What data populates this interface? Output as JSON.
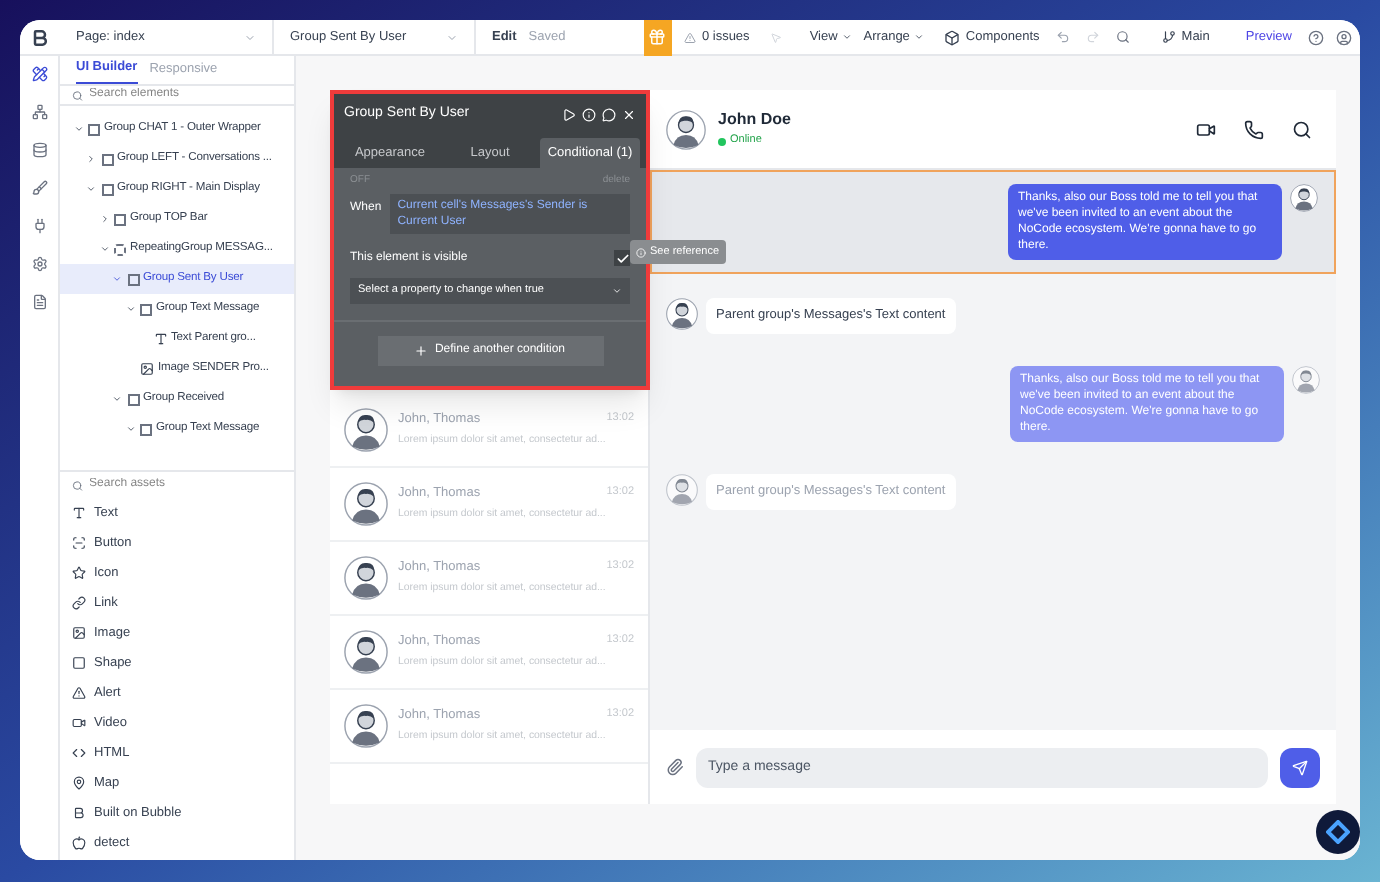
{
  "topbar": {
    "page": "Page: index",
    "element": "Group Sent By User",
    "edit": "Edit",
    "saved": "Saved",
    "issues": "0 issues",
    "view": "View",
    "arrange": "Arrange",
    "components": "Components",
    "branch": "Main",
    "preview": "Preview"
  },
  "left_panel": {
    "tabs": [
      {
        "label": "UI Builder",
        "selected": true
      },
      {
        "label": "Responsive",
        "selected": false
      }
    ],
    "search": {
      "placeholder": "Search elements"
    },
    "layers": [
      {
        "kind": "group",
        "label": "Group CHAT 1 - Outer Wrapper",
        "expanded": true,
        "selected": false,
        "children": [
          {
            "kind": "group",
            "label": "Group LEFT - Conversations ...",
            "expanded": false,
            "selected": false
          },
          {
            "kind": "group",
            "label": "Group RIGHT - Main Display",
            "expanded": true,
            "selected": false,
            "children": [
              {
                "kind": "group",
                "label": "Group TOP Bar",
                "expanded": false,
                "selected": false
              },
              {
                "kind": "repeating",
                "label": "RepeatingGroup MESSAG...",
                "expanded": true,
                "selected": false,
                "children": [
                  {
                    "kind": "group",
                    "label": "Group Sent By User",
                    "expanded": true,
                    "selected": true,
                    "children": [
                      {
                        "kind": "group",
                        "label": "Group Text Message",
                        "expanded": true,
                        "selected": false,
                        "children": [
                          {
                            "kind": "text",
                            "label": "Text Parent gro...",
                            "selected": false
                          }
                        ]
                      },
                      {
                        "kind": "image",
                        "label": "Image SENDER Pro...",
                        "selected": false
                      }
                    ]
                  },
                  {
                    "kind": "group",
                    "label": "Group Received",
                    "expanded": true,
                    "selected": false,
                    "children": [
                      {
                        "kind": "group",
                        "label": "Group Text Message",
                        "expanded": true,
                        "selected": false
                      }
                    ]
                  }
                ]
              }
            ]
          }
        ]
      }
    ],
    "assets_search": {
      "placeholder": "Search assets"
    },
    "assets": [
      {
        "label": "Text"
      },
      {
        "label": "Button"
      },
      {
        "label": "Icon"
      },
      {
        "label": "Link"
      },
      {
        "label": "Image"
      },
      {
        "label": "Shape"
      },
      {
        "label": "Alert"
      },
      {
        "label": "Video"
      },
      {
        "label": "HTML"
      },
      {
        "label": "Map"
      },
      {
        "label": "Built on Bubble"
      },
      {
        "label": "detect"
      }
    ]
  },
  "editor": {
    "title": "Group Sent By User",
    "tabs": [
      {
        "label": "Appearance",
        "selected": false
      },
      {
        "label": "Layout",
        "selected": false
      },
      {
        "label": "Conditional (1)",
        "selected": true
      }
    ],
    "state": "OFF",
    "delete": "delete",
    "when": "When",
    "condition": "Current cell's Messages's Sender is Current User",
    "visible_label": "This element is visible",
    "visible_checked": true,
    "property_placeholder": "Select a property to change when true",
    "add": "Define another condition",
    "tooltip": "See reference"
  },
  "conversations": [
    {
      "name": "John, Thomas",
      "time": "13:02",
      "preview": "Lorem ipsum dolor sit amet, consectetur ad..."
    },
    {
      "name": "John, Thomas",
      "time": "13:02",
      "preview": "Lorem ipsum dolor sit amet, consectetur ad..."
    },
    {
      "name": "John, Thomas",
      "time": "13:02",
      "preview": "Lorem ipsum dolor sit amet, consectetur ad..."
    },
    {
      "name": "John, Thomas",
      "time": "13:02",
      "preview": "Lorem ipsum dolor sit amet, consectetur ad..."
    },
    {
      "name": "John, Thomas",
      "time": "13:02",
      "preview": "Lorem ipsum dolor sit amet, consectetur ad..."
    }
  ],
  "chat": {
    "name": "John Doe",
    "status": "Online",
    "messages": [
      {
        "kind": "sent",
        "text": "Thanks, also our Boss told me to tell you that we've been invited to an event about the NoCode ecosystem. We're gonna have to go there.",
        "selected": true,
        "faded": false
      },
      {
        "kind": "received",
        "text": "Parent group's Messages's Text content",
        "selected": false,
        "faded": false
      },
      {
        "kind": "sent",
        "text": "Thanks, also our Boss told me to tell you that we've been invited to an event about the NoCode ecosystem. We're gonna have to go there.",
        "selected": false,
        "faded": true
      },
      {
        "kind": "received",
        "text": "Parent group's Messages's Text content",
        "selected": false,
        "faded": true
      }
    ],
    "input": {
      "placeholder": "Type a message"
    }
  }
}
